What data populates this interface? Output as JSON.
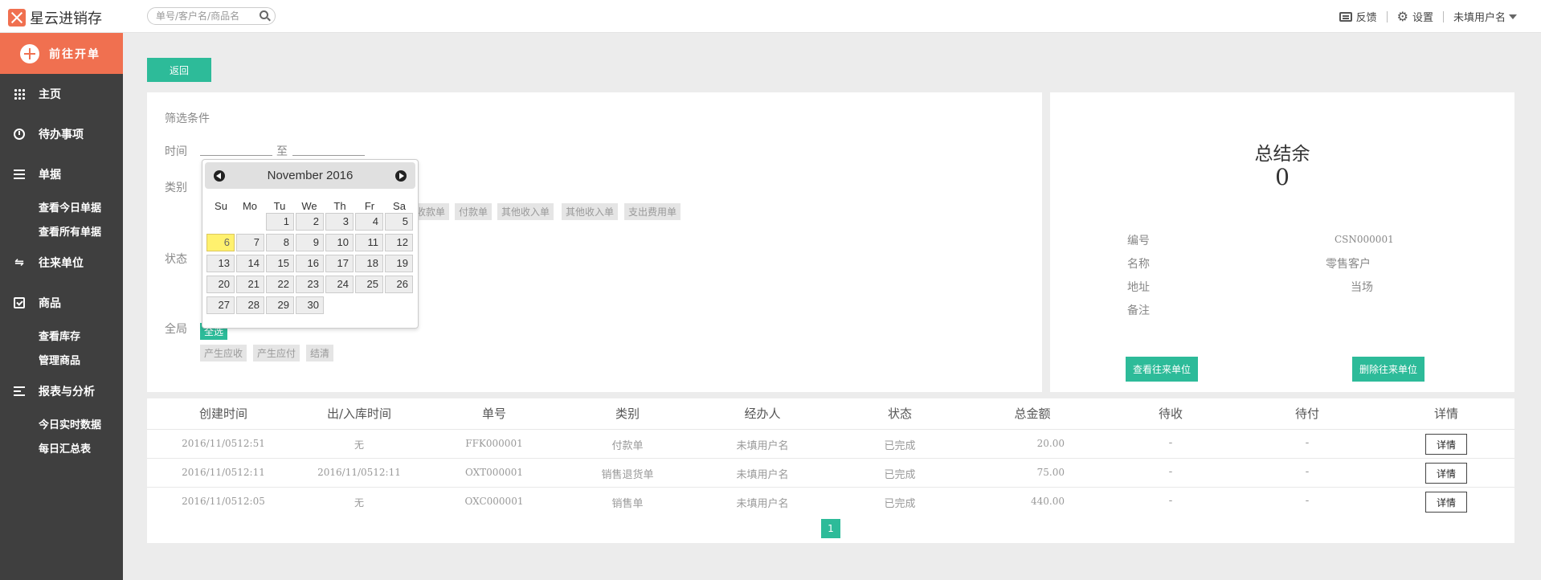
{
  "header": {
    "app_name": "星云进销存",
    "search_placeholder": "单号/客户名/商品名",
    "feedback": "反馈",
    "settings": "设置",
    "user": "未填用户名"
  },
  "sidebar": {
    "new_order": "前往开单",
    "home": "主页",
    "todo": "待办事项",
    "docs": "单据",
    "docs_today": "查看今日单据",
    "docs_all": "查看所有单据",
    "partners": "往来单位",
    "goods": "商品",
    "goods_stock": "查看库存",
    "goods_manage": "管理商品",
    "reports": "报表与分析",
    "reports_realtime": "今日实时数据",
    "reports_daily": "每日汇总表"
  },
  "back_button": "返回",
  "filter": {
    "title": "筛选条件",
    "time_label": "时间",
    "to": "至",
    "category_label": "类别",
    "category_tags": [
      "收款单",
      "付款单",
      "其他收入单",
      "其他收入单",
      "支出费用单"
    ],
    "status_label": "状态",
    "global_label": "全局",
    "global_tags": [
      "全选",
      "产生应收",
      "产生应付",
      "结清"
    ]
  },
  "calendar": {
    "month_title": "November 2016",
    "weekdays": [
      "Su",
      "Mo",
      "Tu",
      "We",
      "Th",
      "Fr",
      "Sa"
    ],
    "days": [
      "1",
      "2",
      "3",
      "4",
      "5",
      "6",
      "7",
      "8",
      "9",
      "10",
      "11",
      "12",
      "13",
      "14",
      "15",
      "16",
      "17",
      "18",
      "19",
      "20",
      "21",
      "22",
      "23",
      "24",
      "25",
      "26",
      "27",
      "28",
      "29",
      "30"
    ],
    "today": "6"
  },
  "summary": {
    "title": "总结余",
    "value": "0",
    "fields": [
      {
        "label": "编号",
        "value": "CSN000001"
      },
      {
        "label": "名称",
        "value": "零售客户"
      },
      {
        "label": "地址",
        "value": "当场"
      },
      {
        "label": "备注",
        "value": ""
      }
    ],
    "view_button": "查看往来单位",
    "delete_button": "删除往来单位"
  },
  "table": {
    "headers": [
      "创建时间",
      "出/入库时间",
      "单号",
      "类别",
      "经办人",
      "状态",
      "总金额",
      "待收",
      "待付",
      "详情"
    ],
    "rows": [
      [
        "2016/11/0512:51",
        "无",
        "FFK000001",
        "付款单",
        "未填用户名",
        "已完成",
        "20.00",
        "-",
        "-",
        "详情"
      ],
      [
        "2016/11/0512:11",
        "2016/11/0512:11",
        "OXT000001",
        "销售退货单",
        "未填用户名",
        "已完成",
        "75.00",
        "-",
        "-",
        "详情"
      ],
      [
        "2016/11/0512:05",
        "无",
        "OXC000001",
        "销售单",
        "未填用户名",
        "已完成",
        "440.00",
        "-",
        "-",
        "详情"
      ]
    ],
    "page": "1"
  }
}
